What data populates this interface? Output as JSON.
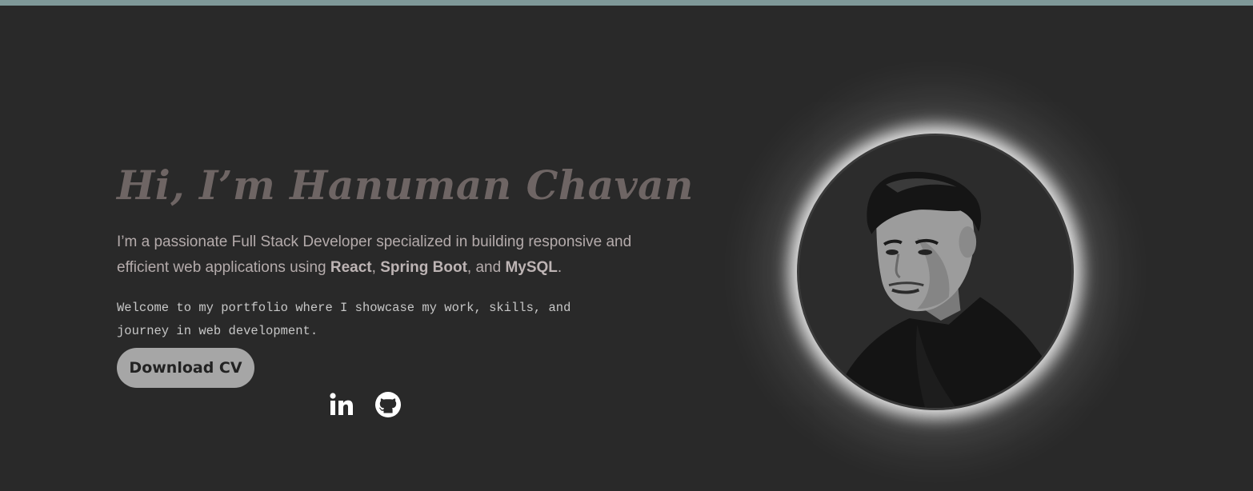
{
  "hero": {
    "heading": "Hi, I’m Hanuman Chavan",
    "bio": {
      "before": "I’m a passionate Full Stack Developer specialized in building responsive and efficient web applications using ",
      "tech1": "React",
      "sep1": ", ",
      "tech2": "Spring Boot",
      "sep2": ", and ",
      "tech3": "MySQL",
      "after": "."
    },
    "welcome": "Welcome to my portfolio where I showcase my work, skills, and journey in web development.",
    "cv_button": "Download CV"
  },
  "social": [
    {
      "icon": "linkedin-icon"
    },
    {
      "icon": "github-icon"
    }
  ],
  "profile_photo": {
    "description_icon": "profile-photo"
  },
  "colors": {
    "background": "#292929",
    "top_strip": "#7f9898",
    "heading": "#6e6564",
    "button": "#a6a6a6"
  }
}
